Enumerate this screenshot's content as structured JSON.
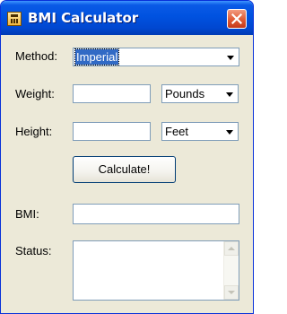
{
  "window": {
    "title": "BMI Calculator",
    "app_icon": "calculator-icon",
    "close_icon": "close-icon"
  },
  "form": {
    "method": {
      "label": "Method:",
      "selected": "Imperial"
    },
    "weight": {
      "label": "Weight:",
      "value": "",
      "unit_selected": "Pounds"
    },
    "height": {
      "label": "Height:",
      "value": "",
      "unit_selected": "Feet"
    },
    "calculate_label": "Calculate!",
    "bmi": {
      "label": "BMI:",
      "value": ""
    },
    "status": {
      "label": "Status:",
      "value": ""
    }
  },
  "colors": {
    "titlebar": "#0052e0",
    "window_bg": "#ece9d8",
    "selection": "#316ac5",
    "close_button": "#e05a34"
  }
}
